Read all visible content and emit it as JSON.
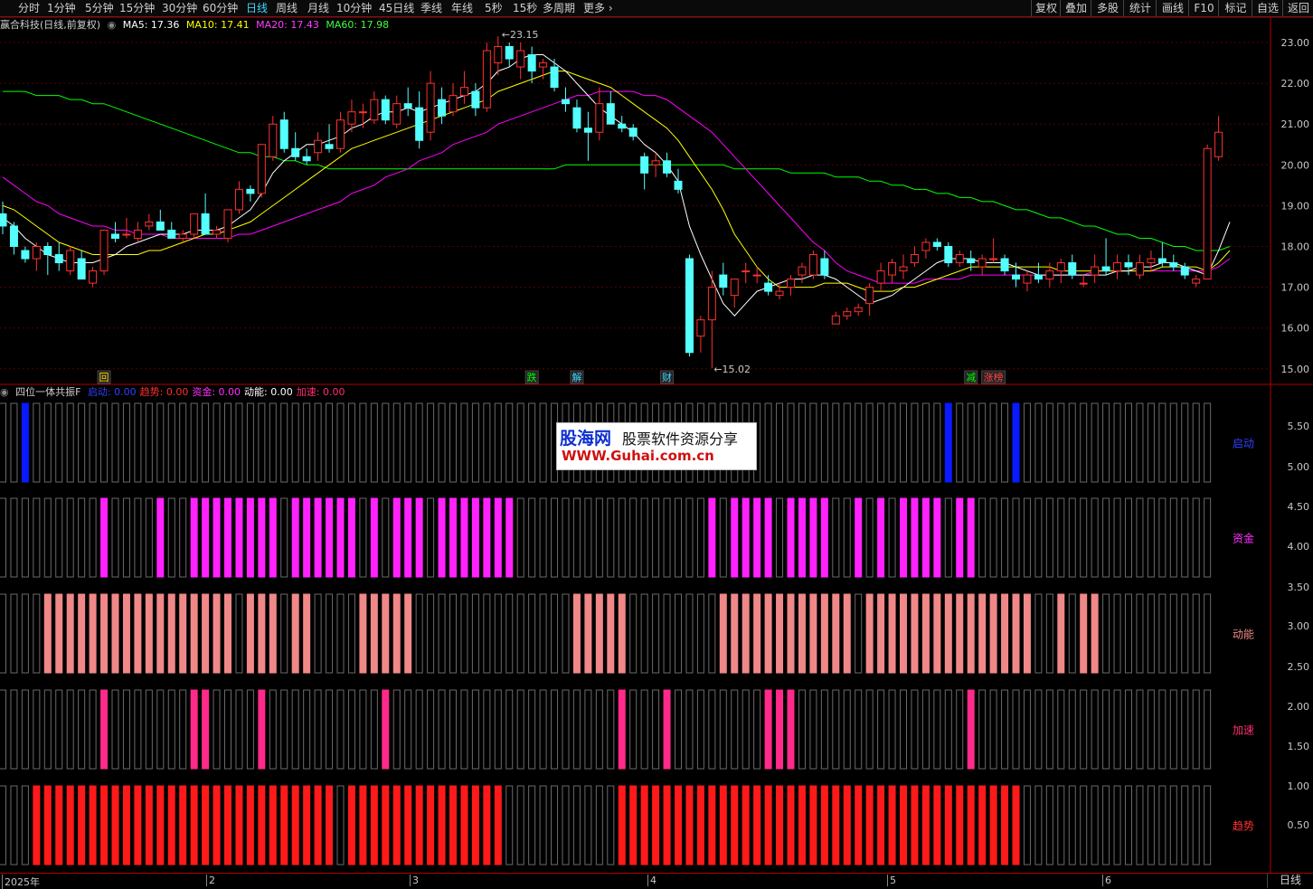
{
  "toolbar": {
    "periods": [
      "分时",
      "1分钟",
      "5分钟",
      "15分钟",
      "30分钟",
      "60分钟",
      "日线",
      "周线",
      "月线",
      "10分钟",
      "45日线",
      "季线",
      "年线",
      "5秒",
      "15秒",
      "多周期",
      "更多"
    ],
    "active_period": "日线",
    "right_buttons": [
      "复权",
      "叠加",
      "多股",
      "统计",
      "画线",
      "F10",
      "标记",
      "自选",
      "返回"
    ]
  },
  "stock": {
    "title": "赢合科技(日线,前复权)",
    "ma5": "MA5: 17.36",
    "ma10": "MA10: 17.41",
    "ma20": "MA20: 17.43",
    "ma60": "MA60: 17.98",
    "colors": {
      "ma5": "#ffffff",
      "ma10": "#ffff00",
      "ma20": "#ff00ff",
      "ma60": "#00ff00",
      "up": "#ff3030",
      "down": "#54ffff"
    }
  },
  "price_axis": [
    "23.00",
    "22.00",
    "21.00",
    "20.00",
    "19.00",
    "18.00",
    "17.00",
    "16.00",
    "15.00"
  ],
  "annotations": {
    "high": "23.15",
    "low": "15.02"
  },
  "event_markers": [
    {
      "text": "回",
      "color": "#ffdd00",
      "x_day": 9
    },
    {
      "text": "跌",
      "color": "#00ff00",
      "x_day": 47
    },
    {
      "text": "解",
      "color": "#3fd6ff",
      "x_day": 51
    },
    {
      "text": "财",
      "color": "#3fd6ff",
      "x_day": 59
    },
    {
      "text": "减",
      "color": "#00ff00",
      "x_day": 86
    },
    {
      "text": "涨榜",
      "color": "#ff4444",
      "x_day": 88
    }
  ],
  "indicator": {
    "name": "四位一体共振F",
    "items": [
      {
        "label": "启动",
        "value": "0.00",
        "color": "#3040ff"
      },
      {
        "label": "趋势",
        "value": "0.00",
        "color": "#ff3030"
      },
      {
        "label": "资金",
        "value": "0.00",
        "color": "#ff30ff"
      },
      {
        "label": "动能",
        "value": "0.00",
        "color": "#ffffff"
      },
      {
        "label": "加速",
        "value": "0.00",
        "color": "#ff3070"
      }
    ],
    "band_labels": [
      "启动",
      "资金",
      "动能",
      "加速",
      "趋势"
    ],
    "axis": [
      "5.50",
      "5.00",
      "4.50",
      "4.00",
      "3.50",
      "3.00",
      "2.50",
      "2.00",
      "1.50",
      "1.00",
      "0.50"
    ]
  },
  "watermark": {
    "line1a": "股海网",
    "line1b": "股票软件资源分享",
    "line2": "WWW.Guhai.com.cn"
  },
  "time_axis": [
    "2025年",
    "2",
    "3",
    "4",
    "5",
    "6"
  ],
  "bottom_button": "日线",
  "chart_data": {
    "type": "candlestick",
    "title": "赢合科技(日线,前复权)",
    "ylim": [
      14.8,
      23.4
    ],
    "ohlc": [
      [
        18.8,
        19.1,
        18.3,
        18.5
      ],
      [
        18.5,
        18.6,
        17.8,
        18.0
      ],
      [
        17.9,
        18.0,
        17.6,
        17.7
      ],
      [
        17.7,
        18.1,
        17.4,
        18.0
      ],
      [
        18.0,
        18.1,
        17.3,
        17.8
      ],
      [
        17.8,
        18.1,
        17.4,
        17.6
      ],
      [
        17.4,
        18.0,
        17.3,
        17.9
      ],
      [
        17.7,
        17.9,
        17.4,
        17.2
      ],
      [
        17.1,
        17.5,
        17.0,
        17.4
      ],
      [
        17.4,
        18.4,
        17.3,
        18.4
      ],
      [
        18.3,
        18.6,
        18.1,
        18.2
      ],
      [
        18.3,
        18.7,
        18.2,
        18.3
      ],
      [
        18.2,
        18.6,
        18.1,
        18.4
      ],
      [
        18.5,
        18.8,
        18.4,
        18.6
      ],
      [
        18.6,
        18.9,
        18.5,
        18.4
      ],
      [
        18.4,
        18.6,
        18.2,
        18.2
      ],
      [
        18.2,
        18.4,
        18.1,
        18.3
      ],
      [
        18.3,
        18.8,
        18.2,
        18.8
      ],
      [
        18.8,
        19.3,
        18.7,
        18.3
      ],
      [
        18.3,
        18.5,
        18.2,
        18.4
      ],
      [
        18.2,
        18.9,
        18.1,
        18.9
      ],
      [
        18.9,
        19.6,
        18.8,
        19.4
      ],
      [
        19.4,
        19.5,
        19.1,
        19.3
      ],
      [
        19.3,
        20.5,
        19.2,
        20.5
      ],
      [
        20.2,
        21.2,
        20.1,
        21.0
      ],
      [
        21.1,
        21.3,
        20.3,
        20.4
      ],
      [
        20.4,
        20.8,
        20.1,
        20.2
      ],
      [
        20.2,
        20.4,
        20.0,
        20.1
      ],
      [
        20.3,
        20.8,
        20.1,
        20.6
      ],
      [
        20.5,
        21.0,
        20.3,
        20.4
      ],
      [
        20.4,
        21.3,
        20.3,
        21.1
      ],
      [
        21.0,
        21.6,
        20.8,
        21.3
      ],
      [
        21.3,
        21.5,
        20.9,
        21.3
      ],
      [
        21.1,
        21.8,
        21.0,
        21.6
      ],
      [
        21.6,
        21.7,
        21.0,
        21.1
      ],
      [
        21.0,
        21.7,
        20.9,
        21.5
      ],
      [
        21.5,
        21.9,
        21.2,
        21.4
      ],
      [
        21.4,
        21.8,
        20.4,
        20.6
      ],
      [
        20.8,
        22.3,
        20.6,
        22.0
      ],
      [
        21.6,
        21.9,
        21.0,
        21.2
      ],
      [
        21.3,
        22.0,
        21.2,
        21.7
      ],
      [
        21.7,
        22.3,
        21.5,
        21.9
      ],
      [
        21.8,
        22.0,
        21.2,
        21.4
      ],
      [
        21.4,
        23.0,
        21.3,
        22.8
      ],
      [
        22.5,
        23.15,
        22.2,
        22.9
      ],
      [
        22.9,
        23.0,
        22.4,
        22.6
      ],
      [
        22.4,
        23.0,
        22.1,
        22.8
      ],
      [
        22.7,
        22.9,
        22.0,
        22.3
      ],
      [
        22.4,
        22.6,
        22.1,
        22.5
      ],
      [
        22.4,
        22.6,
        21.8,
        21.9
      ],
      [
        21.6,
        21.9,
        21.3,
        21.5
      ],
      [
        21.4,
        21.6,
        20.8,
        20.9
      ],
      [
        20.9,
        21.3,
        20.1,
        20.8
      ],
      [
        20.8,
        21.9,
        20.6,
        21.5
      ],
      [
        21.5,
        21.8,
        21.0,
        21.0
      ],
      [
        21.0,
        21.2,
        20.8,
        20.9
      ],
      [
        20.9,
        21.0,
        20.6,
        20.7
      ],
      [
        20.2,
        20.3,
        19.4,
        19.8
      ],
      [
        20.0,
        20.3,
        19.7,
        20.1
      ],
      [
        20.1,
        20.3,
        19.7,
        19.8
      ],
      [
        19.6,
        19.9,
        19.3,
        19.4
      ],
      [
        17.7,
        17.8,
        15.3,
        15.4
      ],
      [
        15.8,
        16.3,
        15.4,
        16.2
      ],
      [
        16.2,
        17.4,
        15.02,
        17.0
      ],
      [
        17.3,
        17.6,
        16.8,
        17.0
      ],
      [
        16.8,
        17.2,
        16.5,
        17.2
      ],
      [
        17.4,
        17.6,
        17.1,
        17.4
      ],
      [
        17.3,
        17.5,
        17.1,
        17.3
      ],
      [
        17.1,
        17.3,
        16.8,
        16.9
      ],
      [
        16.8,
        17.1,
        16.7,
        16.9
      ],
      [
        17.0,
        17.3,
        16.8,
        17.2
      ],
      [
        17.3,
        17.6,
        17.1,
        17.5
      ],
      [
        17.3,
        17.9,
        17.2,
        17.8
      ],
      [
        17.7,
        17.9,
        17.2,
        17.3
      ],
      [
        16.1,
        16.4,
        16.1,
        16.3
      ],
      [
        16.3,
        16.5,
        16.2,
        16.4
      ],
      [
        16.4,
        16.6,
        16.3,
        16.5
      ],
      [
        16.6,
        17.1,
        16.3,
        17.0
      ],
      [
        17.1,
        17.6,
        16.9,
        17.4
      ],
      [
        17.3,
        17.7,
        17.1,
        17.6
      ],
      [
        17.4,
        17.8,
        17.2,
        17.5
      ],
      [
        17.6,
        18.0,
        17.5,
        17.8
      ],
      [
        17.9,
        18.2,
        17.7,
        18.1
      ],
      [
        18.1,
        18.2,
        17.9,
        18.0
      ],
      [
        18.0,
        18.1,
        17.5,
        17.6
      ],
      [
        17.6,
        17.9,
        17.5,
        17.8
      ],
      [
        17.7,
        17.9,
        17.4,
        17.6
      ],
      [
        17.5,
        17.8,
        17.3,
        17.7
      ],
      [
        17.7,
        18.2,
        17.6,
        17.7
      ],
      [
        17.7,
        17.8,
        17.3,
        17.4
      ],
      [
        17.3,
        17.6,
        17.0,
        17.2
      ],
      [
        17.1,
        17.4,
        16.9,
        17.3
      ],
      [
        17.3,
        17.6,
        17.1,
        17.2
      ],
      [
        17.2,
        17.6,
        17.0,
        17.4
      ],
      [
        17.4,
        17.7,
        17.1,
        17.6
      ],
      [
        17.6,
        17.8,
        17.2,
        17.3
      ],
      [
        17.1,
        17.3,
        17.0,
        17.1
      ],
      [
        17.3,
        17.8,
        17.1,
        17.5
      ],
      [
        17.5,
        18.2,
        17.3,
        17.4
      ],
      [
        17.4,
        17.8,
        17.2,
        17.6
      ],
      [
        17.6,
        17.8,
        17.3,
        17.5
      ],
      [
        17.3,
        17.8,
        17.2,
        17.6
      ],
      [
        17.6,
        17.9,
        17.4,
        17.7
      ],
      [
        17.7,
        18.1,
        17.5,
        17.6
      ],
      [
        17.6,
        17.8,
        17.4,
        17.5
      ],
      [
        17.5,
        17.6,
        17.2,
        17.3
      ],
      [
        17.1,
        17.3,
        17.0,
        17.2
      ],
      [
        17.2,
        20.5,
        17.2,
        20.4
      ],
      [
        20.2,
        21.2,
        20.1,
        20.8
      ]
    ],
    "ma5": [
      18.7,
      18.5,
      18.2,
      18.0,
      17.8,
      17.7,
      17.6,
      17.6,
      17.6,
      17.7,
      17.8,
      18.0,
      18.1,
      18.2,
      18.3,
      18.3,
      18.3,
      18.4,
      18.4,
      18.4,
      18.5,
      18.7,
      18.9,
      19.3,
      19.8,
      20.1,
      20.3,
      20.5,
      20.5,
      20.6,
      20.7,
      20.9,
      21.0,
      21.2,
      21.3,
      21.3,
      21.4,
      21.3,
      21.4,
      21.5,
      21.6,
      21.7,
      21.8,
      22.0,
      22.3,
      22.4,
      22.6,
      22.7,
      22.7,
      22.5,
      22.3,
      22.0,
      21.7,
      21.4,
      21.2,
      21.0,
      20.8,
      20.5,
      20.3,
      20.0,
      19.6,
      18.5,
      17.8,
      17.2,
      16.6,
      16.3,
      16.6,
      16.9,
      17.0,
      17.1,
      17.2,
      17.2,
      17.3,
      17.3,
      17.2,
      17.0,
      16.8,
      16.6,
      16.7,
      16.8,
      17.0,
      17.2,
      17.4,
      17.6,
      17.7,
      17.7,
      17.7,
      17.6,
      17.6,
      17.6,
      17.5,
      17.4,
      17.3,
      17.3,
      17.3,
      17.3,
      17.3,
      17.3,
      17.3,
      17.4,
      17.4,
      17.5,
      17.5,
      17.6,
      17.6,
      17.5,
      17.4,
      17.3,
      17.9,
      18.6
    ],
    "ma10": [
      19.0,
      18.9,
      18.7,
      18.5,
      18.3,
      18.1,
      18.0,
      17.9,
      17.8,
      17.8,
      17.8,
      17.8,
      17.8,
      17.9,
      17.9,
      18.0,
      18.1,
      18.2,
      18.3,
      18.3,
      18.4,
      18.5,
      18.6,
      18.8,
      19.0,
      19.2,
      19.4,
      19.6,
      19.8,
      20.0,
      20.2,
      20.4,
      20.5,
      20.6,
      20.7,
      20.8,
      20.9,
      21.0,
      21.1,
      21.2,
      21.3,
      21.4,
      21.5,
      21.6,
      21.8,
      21.9,
      22.0,
      22.1,
      22.2,
      22.3,
      22.3,
      22.2,
      22.1,
      22.0,
      21.9,
      21.7,
      21.5,
      21.3,
      21.1,
      20.9,
      20.6,
      20.2,
      19.8,
      19.4,
      18.9,
      18.3,
      17.9,
      17.5,
      17.2,
      17.0,
      17.0,
      17.0,
      17.0,
      17.1,
      17.1,
      17.1,
      17.0,
      16.9,
      16.9,
      16.9,
      17.0,
      17.0,
      17.1,
      17.2,
      17.3,
      17.4,
      17.5,
      17.5,
      17.5,
      17.5,
      17.5,
      17.5,
      17.5,
      17.5,
      17.4,
      17.4,
      17.4,
      17.4,
      17.4,
      17.4,
      17.4,
      17.4,
      17.4,
      17.5,
      17.5,
      17.5,
      17.5,
      17.4,
      17.6,
      17.9
    ],
    "ma20": [
      19.7,
      19.5,
      19.3,
      19.1,
      19.0,
      18.8,
      18.7,
      18.6,
      18.5,
      18.5,
      18.4,
      18.4,
      18.3,
      18.3,
      18.3,
      18.2,
      18.2,
      18.2,
      18.2,
      18.2,
      18.2,
      18.3,
      18.3,
      18.4,
      18.5,
      18.6,
      18.7,
      18.8,
      18.9,
      19.0,
      19.1,
      19.3,
      19.4,
      19.5,
      19.7,
      19.8,
      19.9,
      20.1,
      20.2,
      20.3,
      20.5,
      20.6,
      20.7,
      20.8,
      21.0,
      21.1,
      21.2,
      21.3,
      21.4,
      21.5,
      21.6,
      21.7,
      21.7,
      21.8,
      21.8,
      21.8,
      21.8,
      21.7,
      21.7,
      21.6,
      21.4,
      21.2,
      21.0,
      20.8,
      20.5,
      20.2,
      19.9,
      19.6,
      19.3,
      19.0,
      18.7,
      18.4,
      18.1,
      17.9,
      17.6,
      17.4,
      17.3,
      17.2,
      17.1,
      17.1,
      17.1,
      17.1,
      17.2,
      17.2,
      17.2,
      17.2,
      17.3,
      17.3,
      17.3,
      17.3,
      17.3,
      17.3,
      17.3,
      17.3,
      17.3,
      17.3,
      17.3,
      17.4,
      17.4,
      17.4,
      17.4,
      17.4,
      17.4,
      17.4,
      17.4,
      17.4,
      17.4,
      17.4,
      17.5,
      17.7
    ],
    "ma60": [
      21.8,
      21.8,
      21.8,
      21.7,
      21.7,
      21.7,
      21.6,
      21.6,
      21.5,
      21.5,
      21.4,
      21.3,
      21.2,
      21.1,
      21.0,
      20.9,
      20.8,
      20.7,
      20.6,
      20.5,
      20.4,
      20.3,
      20.3,
      20.2,
      20.2,
      20.1,
      20.1,
      20.0,
      20.0,
      19.9,
      19.9,
      19.9,
      19.9,
      19.9,
      19.9,
      19.9,
      19.9,
      19.9,
      19.9,
      19.9,
      19.9,
      19.9,
      19.9,
      19.9,
      19.9,
      19.9,
      19.9,
      19.9,
      19.9,
      19.9,
      20.0,
      20.0,
      20.0,
      20.0,
      20.0,
      20.0,
      20.0,
      20.0,
      20.0,
      20.0,
      20.0,
      20.0,
      20.0,
      20.0,
      20.0,
      19.9,
      19.9,
      19.9,
      19.9,
      19.9,
      19.8,
      19.8,
      19.8,
      19.8,
      19.7,
      19.7,
      19.7,
      19.6,
      19.6,
      19.5,
      19.5,
      19.4,
      19.4,
      19.3,
      19.3,
      19.2,
      19.2,
      19.1,
      19.1,
      19.0,
      18.9,
      18.9,
      18.8,
      18.7,
      18.7,
      18.6,
      18.5,
      18.5,
      18.4,
      18.3,
      18.3,
      18.2,
      18.2,
      18.1,
      18.0,
      18.0,
      17.9,
      17.9,
      17.9,
      18.0
    ],
    "indicator_bands": {
      "qidong": [
        2,
        84,
        90
      ],
      "zijin": [
        9,
        14,
        17,
        18,
        19,
        20,
        21,
        22,
        23,
        24,
        26,
        27,
        28,
        29,
        30,
        31,
        33,
        35,
        36,
        37,
        39,
        40,
        41,
        42,
        43,
        44,
        45,
        63,
        65,
        66,
        67,
        68,
        70,
        71,
        72,
        73,
        76,
        78,
        80,
        81,
        82,
        83,
        85,
        86
      ],
      "dongneng": [
        4,
        5,
        6,
        7,
        8,
        9,
        10,
        11,
        12,
        13,
        14,
        15,
        16,
        17,
        18,
        19,
        20,
        22,
        23,
        24,
        26,
        27,
        32,
        33,
        34,
        35,
        36,
        51,
        52,
        53,
        54,
        55,
        64,
        65,
        66,
        67,
        68,
        69,
        70,
        71,
        72,
        73,
        74,
        75,
        77,
        78,
        79,
        80,
        81,
        82,
        83,
        84,
        85,
        86,
        87,
        88,
        89,
        90,
        91,
        94,
        96,
        97
      ],
      "jiasu": [
        9,
        17,
        18,
        23,
        34,
        55,
        59,
        68,
        69,
        70,
        86
      ],
      "qushi": [
        3,
        4,
        5,
        6,
        7,
        8,
        9,
        10,
        11,
        12,
        13,
        14,
        15,
        16,
        17,
        18,
        19,
        20,
        21,
        22,
        23,
        24,
        25,
        26,
        27,
        28,
        29,
        31,
        32,
        33,
        34,
        35,
        36,
        37,
        38,
        39,
        40,
        41,
        42,
        43,
        44,
        55,
        56,
        57,
        58,
        59,
        60,
        61,
        62,
        63,
        64,
        65,
        66,
        67,
        68,
        69,
        70,
        71,
        72,
        73,
        74,
        75,
        76,
        77,
        78,
        79,
        80,
        81,
        82,
        83,
        84,
        85,
        86,
        87,
        88,
        89,
        90
      ]
    }
  }
}
